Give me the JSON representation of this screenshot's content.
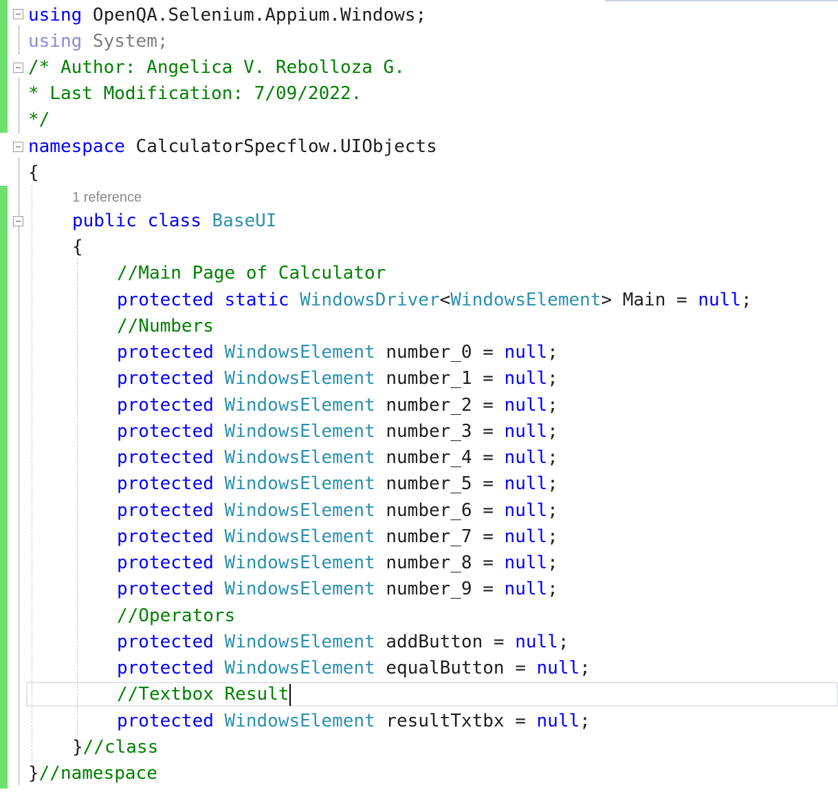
{
  "editor": {
    "code_lens": "1 reference",
    "lines": {
      "l1": {
        "kw": "using",
        "rest": " OpenQA.Selenium.Appium.Windows;"
      },
      "l2": {
        "kw": "using",
        "rest": " System;"
      },
      "l3": {
        "comment": "/* Author: Angelica V. Rebolloza G."
      },
      "l4": {
        "comment": "* Last Modification: 7/09/2022."
      },
      "l5": {
        "comment": "*/"
      },
      "l6": {
        "kw": "namespace",
        "rest": " CalculatorSpecflow.UIObjects"
      },
      "l7": {
        "text": "{"
      },
      "l8": {
        "kw1": "public",
        "kw2": "class",
        "type": "BaseUI"
      },
      "l9": {
        "text": "{"
      },
      "l10": {
        "comment": "//Main Page of Calculator"
      },
      "l11": {
        "kw1": "protected",
        "kw2": "static",
        "type1": "WindowsDriver",
        "lt": "<",
        "type2": "WindowsElement",
        "rest": "> Main = ",
        "value": "null",
        "end": ";"
      },
      "l12": {
        "comment": "//Numbers"
      },
      "fields": [
        {
          "kw": "protected",
          "type": "WindowsElement",
          "name": " number_0 = ",
          "value": "null",
          "end": ";"
        },
        {
          "kw": "protected",
          "type": "WindowsElement",
          "name": " number_1 = ",
          "value": "null",
          "end": ";"
        },
        {
          "kw": "protected",
          "type": "WindowsElement",
          "name": " number_2 = ",
          "value": "null",
          "end": ";"
        },
        {
          "kw": "protected",
          "type": "WindowsElement",
          "name": " number_3 = ",
          "value": "null",
          "end": ";"
        },
        {
          "kw": "protected",
          "type": "WindowsElement",
          "name": " number_4 = ",
          "value": "null",
          "end": ";"
        },
        {
          "kw": "protected",
          "type": "WindowsElement",
          "name": " number_5 = ",
          "value": "null",
          "end": ";"
        },
        {
          "kw": "protected",
          "type": "WindowsElement",
          "name": " number_6 = ",
          "value": "null",
          "end": ";"
        },
        {
          "kw": "protected",
          "type": "WindowsElement",
          "name": " number_7 = ",
          "value": "null",
          "end": ";"
        },
        {
          "kw": "protected",
          "type": "WindowsElement",
          "name": " number_8 = ",
          "value": "null",
          "end": ";"
        },
        {
          "kw": "protected",
          "type": "WindowsElement",
          "name": " number_9 = ",
          "value": "null",
          "end": ";"
        }
      ],
      "l23": {
        "comment": "//Operators"
      },
      "l24": {
        "kw": "protected",
        "type": "WindowsElement",
        "name": " addButton = ",
        "value": "null",
        "end": ";"
      },
      "l25": {
        "kw": "protected",
        "type": "WindowsElement",
        "name": " equalButton = ",
        "value": "null",
        "end": ";"
      },
      "l26": {
        "comment": "//Textbox Result"
      },
      "l27": {
        "kw": "protected",
        "type": "WindowsElement",
        "name": " resultTxtbx = ",
        "value": "null",
        "end": ";"
      },
      "l28": {
        "text": "}",
        "comment": "//class"
      },
      "l29": {
        "text": "}",
        "comment": "//namespace"
      }
    }
  },
  "colors": {
    "keyword": "#0000ff",
    "comment": "#008000",
    "type": "#2b91af",
    "text": "#1e1e1e",
    "change_bar": "#6ee06e"
  }
}
